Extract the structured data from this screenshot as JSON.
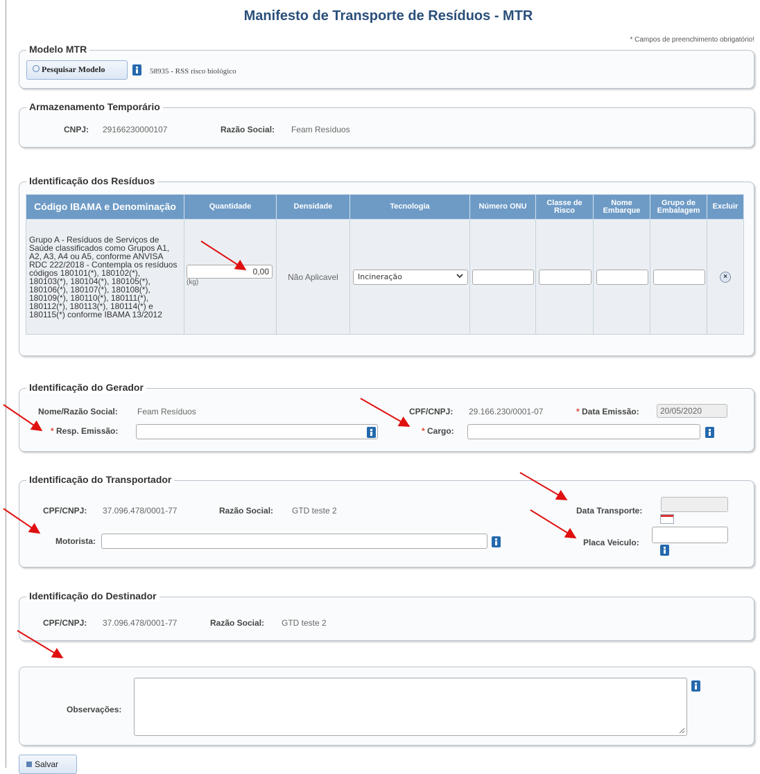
{
  "page": {
    "title": "Manifesto de Transporte de Resíduos - MTR",
    "required_note": "* Campos de preenchimento obrigatório!"
  },
  "modelo": {
    "legend": "Modelo MTR",
    "search_button": "Pesquisar Modelo",
    "selected_model": "58935 - RSS risco biológico"
  },
  "armazenamento": {
    "legend": "Armazenamento Temporário",
    "cnpj_label": "CNPJ:",
    "cnpj_value": "29166230000107",
    "razao_label": "Razão Social:",
    "razao_value": "Feam Resíduos"
  },
  "residuos": {
    "legend": "Identificação dos Resíduos",
    "headers": [
      "Código IBAMA e Denominação",
      "Quantidade",
      "Densidade",
      "Tecnologia",
      "Número ONU",
      "Classe de Risco",
      "Nome Embarque",
      "Grupo de Embalagem",
      "Excluir"
    ],
    "row": {
      "description": "Grupo A - Resíduos de Serviços de Saúde classificados como Grupos A1, A2, A3, A4 ou A5, conforme ANVISA RDC 222/2018 - Contempla os resíduos códigos 180101(*), 180102(*), 180103(*), 180104(*), 180105(*), 180106(*), 180107(*), 180108(*), 180109(*), 180110(*), 180111(*), 180112(*), 180113(*), 180114(*) e 180115(*) conforme IBAMA 13/2012",
      "quantity": "0,00",
      "unit": "(kg)",
      "density": "Não Aplicavel",
      "technology": "Incineração"
    }
  },
  "gerador": {
    "legend": "Identificação do Gerador",
    "nome_label": "Nome/Razão Social:",
    "nome_value": "Feam Resíduos",
    "cpf_label": "CPF/CNPJ:",
    "cpf_value": "29.166.230/0001-07",
    "data_label": "Data Emissão:",
    "data_value": "20/05/2020",
    "resp_label": "Resp. Emissão:",
    "cargo_label": "Cargo:"
  },
  "transportador": {
    "legend": "Identificação do Transportador",
    "cpf_label": "CPF/CNPJ:",
    "cpf_value": "37.096.478/0001-77",
    "razao_label": "Razão Social:",
    "razao_value": "GTD teste 2",
    "data_label": "Data Transporte:",
    "motorista_label": "Motorista:",
    "placa_label": "Placa Veiculo:"
  },
  "destinador": {
    "legend": "Identificação do Destinador",
    "cpf_label": "CPF/CNPJ:",
    "cpf_value": "37.096.478/0001-77",
    "razao_label": "Razão Social:",
    "razao_value": "GTD teste 2"
  },
  "observacoes": {
    "label": "Observações:"
  },
  "actions": {
    "save_label": "Salvar"
  },
  "colors": {
    "header_blue": "#6e9bc6",
    "title_blue": "#2a4f7a",
    "annotation_red": "#e01010"
  }
}
